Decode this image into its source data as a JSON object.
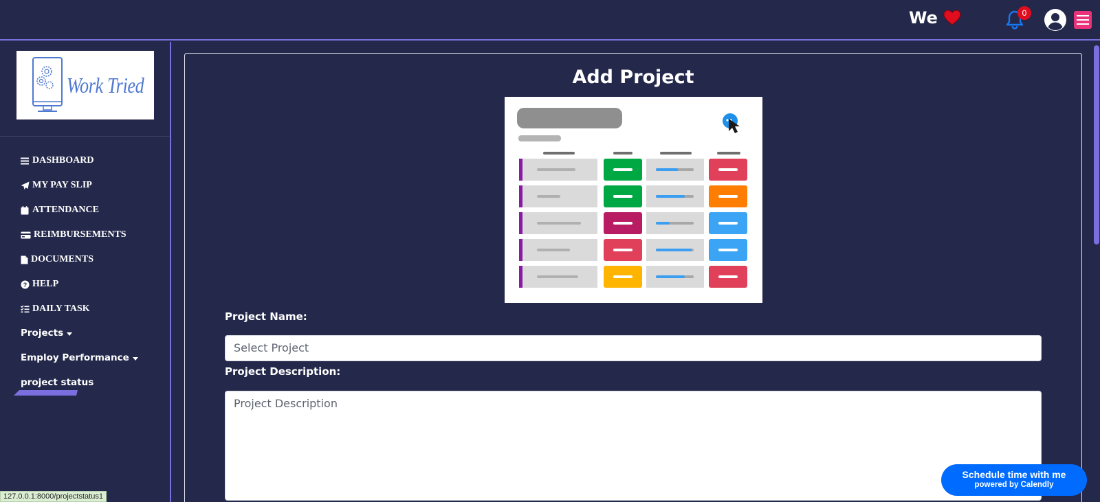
{
  "header": {
    "we_text": "We",
    "heart_icon": "heart-icon",
    "notification_count": "0",
    "bell_icon": "bell-icon",
    "avatar_icon": "user-circle-icon",
    "menu_icon": "hamburger-icon",
    "accent_color": "#e8337a"
  },
  "sidebar": {
    "logo_text": "Work Tried",
    "items": [
      {
        "label": "DASHBOARD",
        "icon": "bars-icon"
      },
      {
        "label": "MY PAY SLIP",
        "icon": "paper-plane-icon"
      },
      {
        "label": "ATTENDANCE",
        "icon": "calendar-icon"
      },
      {
        "label": "REIMBURSEMENTS",
        "icon": "credit-card-icon"
      },
      {
        "label": "DOCUMENTS",
        "icon": "file-icon"
      },
      {
        "label": "HELP",
        "icon": "question-circle-icon"
      },
      {
        "label": "DAILY TASK",
        "icon": "list-check-icon"
      },
      {
        "label": "Projects"
      },
      {
        "label": "Employ Performance"
      },
      {
        "label": "project status"
      }
    ]
  },
  "main": {
    "title": "Add Project",
    "project_name_label": "Project Name:",
    "project_name_value": "Select Project",
    "project_desc_label": "Project Description:",
    "project_desc_placeholder": "Project Description"
  },
  "calendly": {
    "title": "Schedule time with me",
    "subtitle": "powered by Calendly",
    "color": "#006bff"
  },
  "status_url": "127.0.0.1:8000/projectstatus1"
}
